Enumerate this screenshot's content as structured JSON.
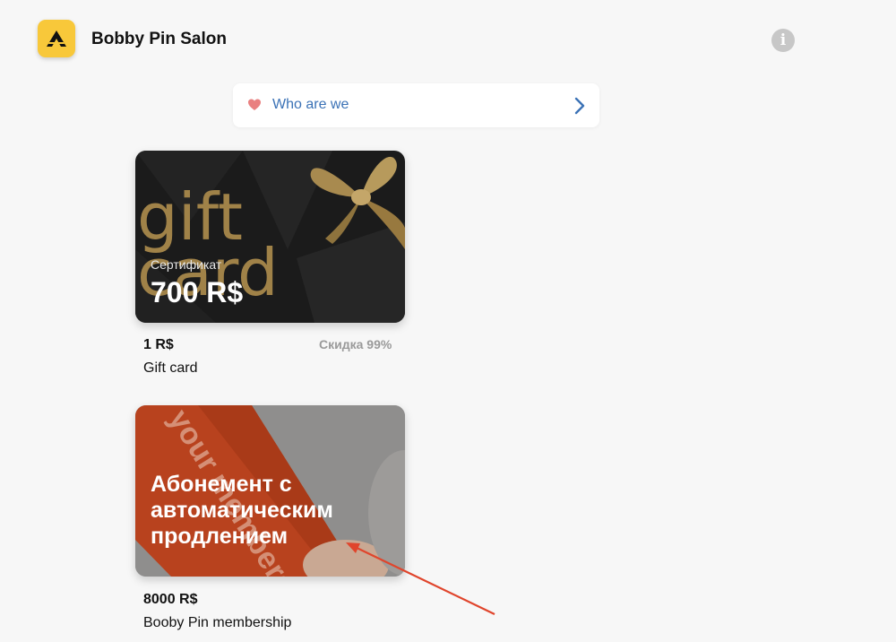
{
  "header": {
    "title": "Bobby Pin Salon",
    "logo_icon": "triangle-logo-icon",
    "info_icon": "info-icon",
    "info_glyph": "i"
  },
  "who_bar": {
    "label": "Who are we",
    "heart_icon": "heart-icon",
    "chevron_icon": "chevron-right-icon",
    "heart_color": "#e98080",
    "label_color": "#3b72b6"
  },
  "products": [
    {
      "card_subtitle": "Сертификат",
      "card_amount": "700 R$",
      "card_image_text": "gift card",
      "price": "1 R$",
      "discount": "Скидка 99%",
      "name": "Gift card"
    },
    {
      "card_title": "Абонемент с автоматическим продлением",
      "card_image_text": "your membership",
      "price": "8000 R$",
      "name": "Booby Pin membership"
    }
  ],
  "annotation": {
    "arrow_color": "#e0452c"
  },
  "colors": {
    "accent": "#f8c83a",
    "background": "#f7f7f7"
  }
}
